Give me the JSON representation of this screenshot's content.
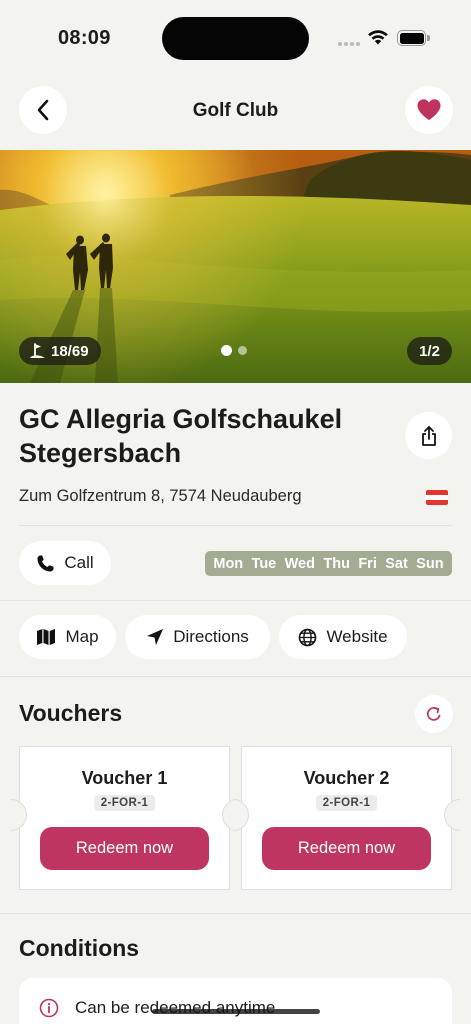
{
  "status_bar": {
    "time": "08:09"
  },
  "nav": {
    "title": "Golf Club",
    "back_icon": "chevron-left-icon",
    "favorite_icon": "heart-icon",
    "favorite_color": "#c0335f"
  },
  "hero": {
    "holes": "18/69",
    "image_counter": "1/2",
    "current_page": 1,
    "page_count": 2
  },
  "club": {
    "name": "GC Allegria Golfschaukel Stegersbach",
    "address": "Zum Golfzentrum 8, 7574 Neudauberg",
    "country_flag": "austria-flag"
  },
  "actions": {
    "call": "Call",
    "map": "Map",
    "directions": "Directions",
    "website": "Website"
  },
  "opening_days": [
    "Mon",
    "Tue",
    "Wed",
    "Thu",
    "Fri",
    "Sat",
    "Sun"
  ],
  "vouchers": {
    "title": "Vouchers",
    "items": [
      {
        "title": "Voucher 1",
        "tag": "2-FOR-1",
        "button": "Redeem now"
      },
      {
        "title": "Voucher 2",
        "tag": "2-FOR-1",
        "button": "Redeem now"
      }
    ]
  },
  "conditions": {
    "title": "Conditions",
    "items": [
      {
        "text": "Can be redeemed anytime"
      }
    ]
  },
  "colors": {
    "accent": "#bf3562",
    "days_badge": "#a3ab93",
    "background": "#f3f3ef"
  }
}
